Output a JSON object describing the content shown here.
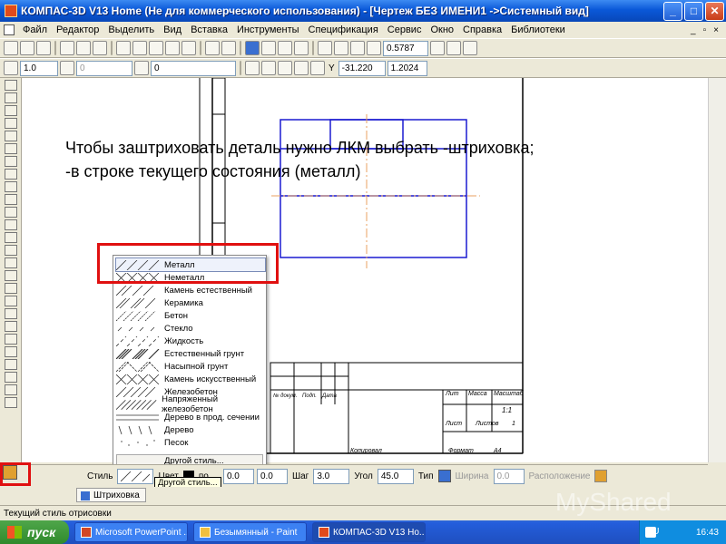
{
  "window": {
    "title": "КОМПАС-3D V13 Home (Не для коммерческого использования) - [Чертеж БЕЗ ИМЕНИ1 ->Системный вид]",
    "min": "_",
    "max": "□",
    "close": "✕"
  },
  "menu": [
    "Файл",
    "Редактор",
    "Выделить",
    "Вид",
    "Вставка",
    "Инструменты",
    "Спецификация",
    "Сервис",
    "Окно",
    "Справка",
    "Библиотеки"
  ],
  "menu_ctrls": [
    "_",
    "▫",
    "×"
  ],
  "toolbar1": {
    "zoom": "0.5787"
  },
  "toolbar2": {
    "line_width": "1.0",
    "layer": "0",
    "style": "0",
    "coord_x": "-31.220",
    "coord_y": "1.2024"
  },
  "overlay": {
    "line1": "Чтобы заштриховать деталь нужно ЛКМ выбрать -штриховка;",
    "line2": "-в строке текущего состояния (металл)"
  },
  "hatch_menu": {
    "items": [
      "Металл",
      "Неметалл",
      "Камень естественный",
      "Керамика",
      "Бетон",
      "Стекло",
      "Жидкость",
      "Естественный грунт",
      "Насыпной грунт",
      "Камень искусственный",
      "Железобетон",
      "Напряженный железобетон",
      "Дерево в прод. сечении",
      "Дерево",
      "Песок"
    ],
    "other": "Другой стиль..."
  },
  "titleblock": {
    "lit": "Лит",
    "massa": "Масса",
    "masshtab": "Масштаб",
    "scale": "1:1",
    "list": "Лист",
    "listov": "Листов",
    "listov_val": "1",
    "n_dokum": "№ докум.",
    "podp": "Подп.",
    "data": "Дата",
    "kopiroval": "Копировал",
    "format": "Формат",
    "format_val": "A4"
  },
  "propbar": {
    "style_label": "Стиль",
    "color_label": "Цвет",
    "color_value": "по ...",
    "x_value": "0.0",
    "y_value": "0.0",
    "step_label": "Шаг",
    "step_value": "3.0",
    "angle_label": "Угол",
    "angle_value": "45.0",
    "type_label": "Тип",
    "width_label": "Ширина",
    "width_value": "0.0",
    "position_label": "Расположение"
  },
  "tooltip": "Другой стиль...",
  "tab": "Штриховка",
  "status": "Текущий стиль отрисовки",
  "taskbar": {
    "start": "пуск",
    "tasks": [
      "Microsoft PowerPoint ...",
      "Безымянный - Paint",
      "КОМПАС-3D V13 Ho..."
    ],
    "lang": "RU",
    "time": "16:43"
  },
  "watermark": "MyShared",
  "colors": {
    "drawing_lines": "#1a1ad0",
    "axis_lines": "#e8a060",
    "highlight": "#e01010"
  }
}
